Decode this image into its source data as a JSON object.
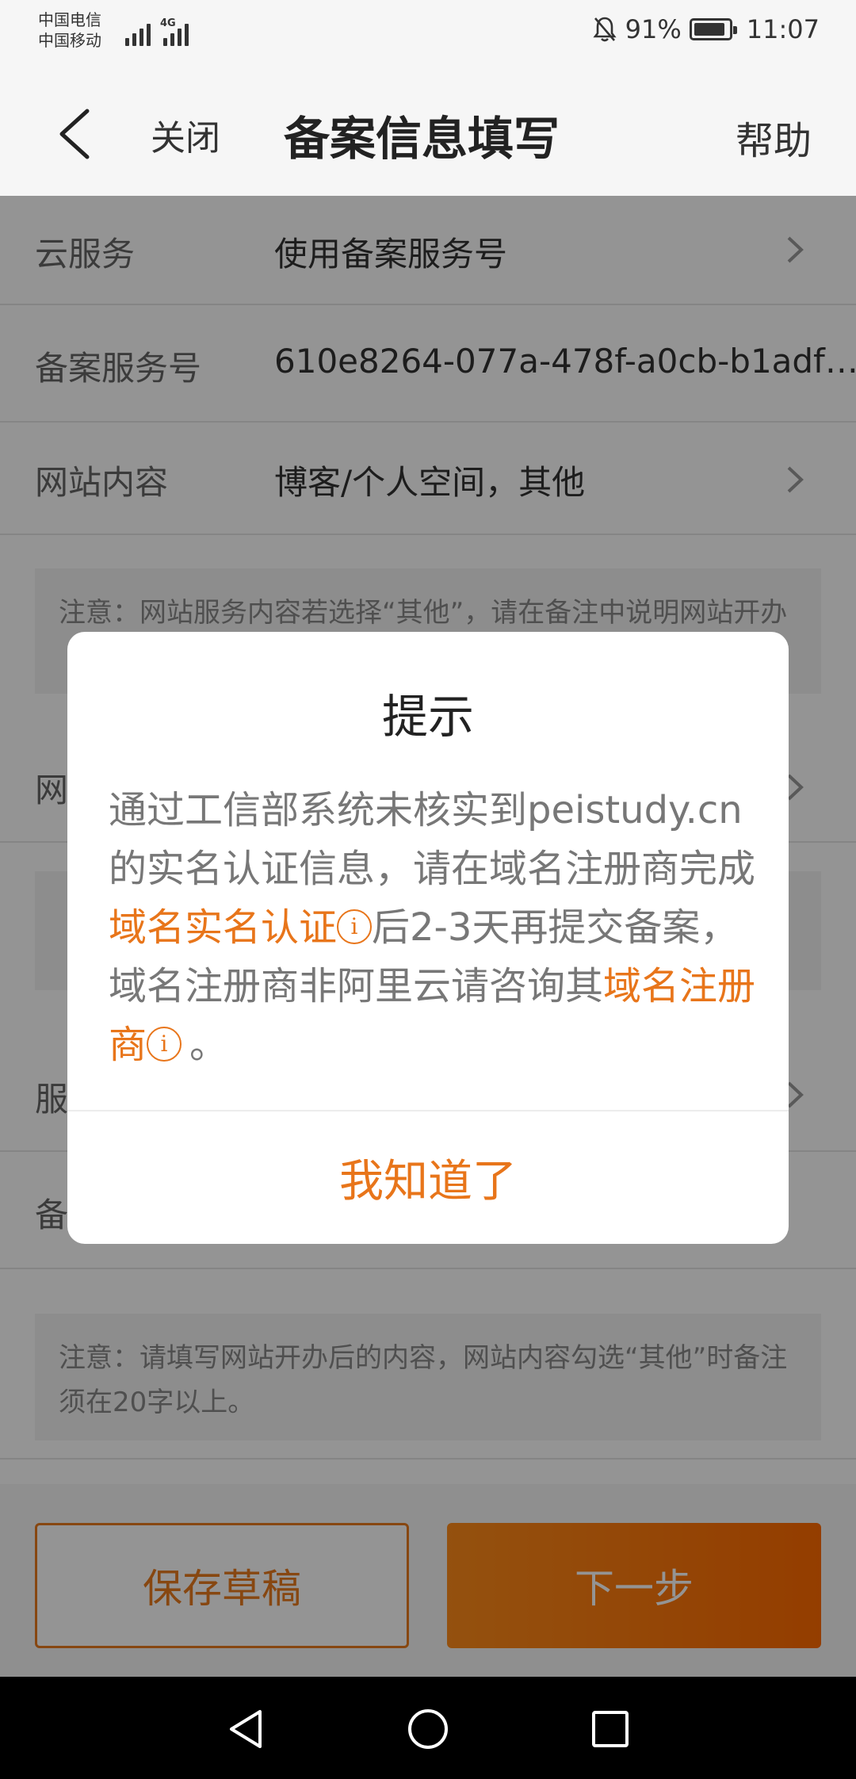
{
  "status_bar": {
    "carrier_1": "中国电信",
    "carrier_2": "中国移动",
    "network": "4G",
    "battery": "91%",
    "time": "11:07",
    "icons": [
      "signal-icon",
      "mute-bell-icon",
      "battery-icon"
    ]
  },
  "header": {
    "close_label": "关闭",
    "title": "备案信息填写",
    "help_label": "帮助"
  },
  "form": {
    "rows": [
      {
        "label": "云服务",
        "value": "使用备案服务号"
      },
      {
        "label": "备案服务号",
        "value": "610e8264-077a-478f-a0cb-b1adf…"
      },
      {
        "label": "网站内容",
        "value": "博客/个人空间，其他"
      },
      {
        "label": "网"
      },
      {
        "label": "服"
      },
      {
        "label": "备"
      }
    ],
    "note_1": "注意：网站服务内容若选择“其他”，请在备注中说明网站开办",
    "note_2": "注意：请填写网站开办后的内容，网站内容勾选“其他”时备注须在20字以上。"
  },
  "bottom": {
    "draft_label": "保存草稿",
    "next_label": "下一步"
  },
  "dialog": {
    "title": "提示",
    "msg_part1": "通过工信部系统未核实到peistudy.cn的实名认证信息，请在域名注册商完成",
    "link_1": "域名实名认证",
    "msg_part2": "后2-3天再提交备案，域名注册商非阿里云请咨询其",
    "link_2": "域名注册商",
    "msg_part3": "。",
    "info_glyph": "i",
    "confirm_label": "我知道了"
  },
  "colors": {
    "accent": "#e8751a",
    "overlay": "rgba(0,0,0,0.42)"
  }
}
